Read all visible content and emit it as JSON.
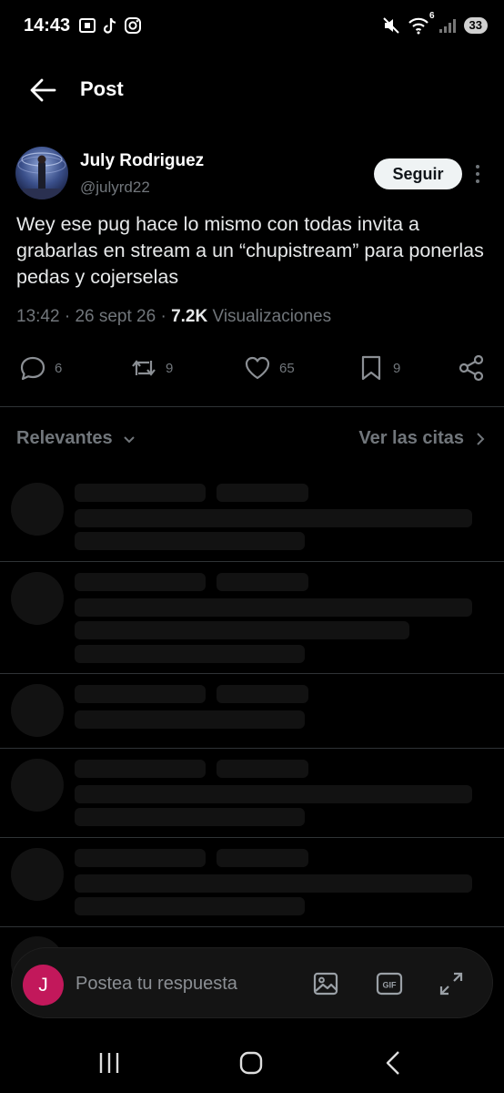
{
  "status_bar": {
    "time": "14:43",
    "battery": "33",
    "network": "6"
  },
  "header": {
    "title": "Post"
  },
  "post": {
    "author_name": "July Rodriguez",
    "author_handle": "@julyrd22",
    "follow_label": "Seguir",
    "text": "Wey ese pug hace lo mismo con todas invita a grabarlas en stream a un “chupistream” para ponerlas pedas y cojerselas",
    "time": "13:42",
    "date": "26 sept 26",
    "views_count": "7.2K",
    "views_label": "Visualizaciones",
    "replies": "6",
    "reposts": "9",
    "likes": "65",
    "bookmarks": "9"
  },
  "filters": {
    "sort_label": "Relevantes",
    "quotes_label": "Ver las citas"
  },
  "reply": {
    "avatar_initial": "J",
    "placeholder": "Postea tu respuesta",
    "gif_label": "GIF"
  },
  "colors": {
    "background": "#000000",
    "text_primary": "#e7e9ea",
    "text_secondary": "#71767b",
    "divider": "#2f3336",
    "skeleton": "#121212",
    "reply_avatar": "#c2185b"
  },
  "icons": {
    "back": "arrow-left-icon",
    "more": "more-vertical-icon",
    "reply": "comment-icon",
    "repost": "repost-icon",
    "like": "heart-icon",
    "bookmark": "bookmark-icon",
    "share": "share-icon",
    "image": "image-icon",
    "gif": "gif-icon",
    "expand": "expand-icon"
  }
}
